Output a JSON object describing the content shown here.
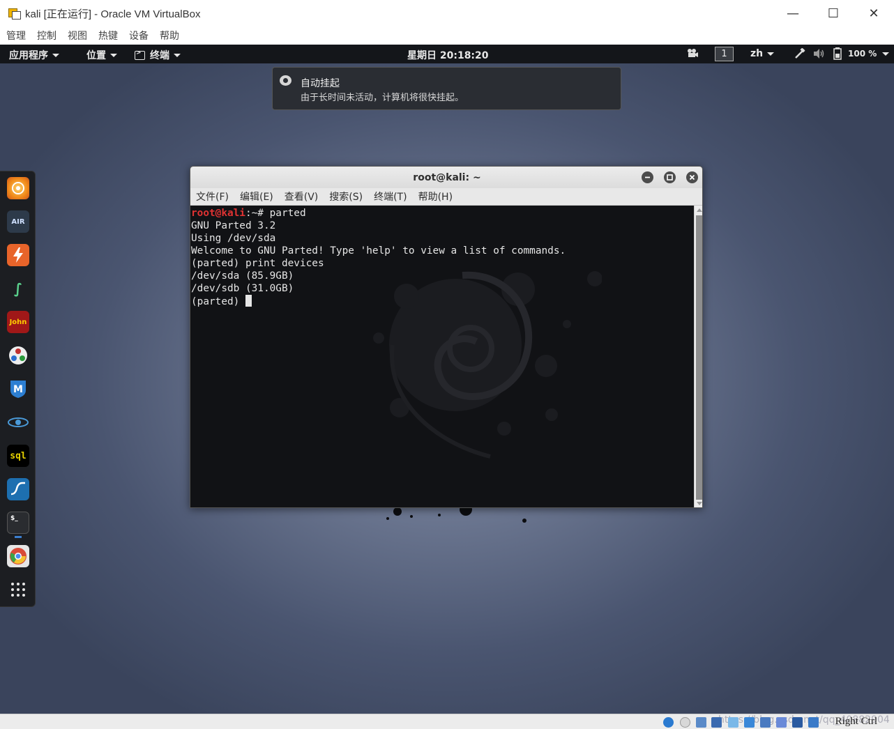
{
  "host": {
    "title": "kali [正在运行] - Oracle VM VirtualBox",
    "menu": [
      "管理",
      "控制",
      "视图",
      "热键",
      "设备",
      "帮助"
    ],
    "window_controls": {
      "minimize": "—",
      "maximize": "☐",
      "close": "✕"
    },
    "status": {
      "host_key": "Right Ctrl",
      "watermark": "https://blog.csdn.net/qq_40882904"
    }
  },
  "topbar": {
    "applications": "应用程序",
    "places": "位置",
    "terminal": "终端",
    "clock": "星期日 20:18:20",
    "workspace": "1",
    "language": "zh",
    "battery": "100 %"
  },
  "notification": {
    "title": "自动挂起",
    "body": "由于长时间未活动，计算机将很快挂起。"
  },
  "dock": {
    "items": [
      "firefox-esr",
      "aircrack-ng",
      "burpsuite",
      "faraday",
      "john",
      "maltego",
      "metasploit",
      "netdiscover",
      "sqlmap",
      "wireshark",
      "terminal",
      "chromium",
      "show-applications"
    ]
  },
  "terminal": {
    "title": "root@kali: ~",
    "menu": [
      "文件(F)",
      "编辑(E)",
      "查看(V)",
      "搜索(S)",
      "终端(T)",
      "帮助(H)"
    ],
    "prompt_user": "root@kali",
    "prompt_sep": ":~# ",
    "command": "parted",
    "lines": [
      "GNU Parted 3.2",
      "Using /dev/sda",
      "Welcome to GNU Parted! Type 'help' to view a list of commands.",
      "(parted) print devices",
      "/dev/sda (85.9GB)",
      "/dev/sdb (31.0GB)"
    ],
    "current_prompt": "(parted) "
  },
  "colors": {
    "prompt_user": "#e03232",
    "terminal_bg": "#111215",
    "topbar_bg": "#14161a"
  }
}
